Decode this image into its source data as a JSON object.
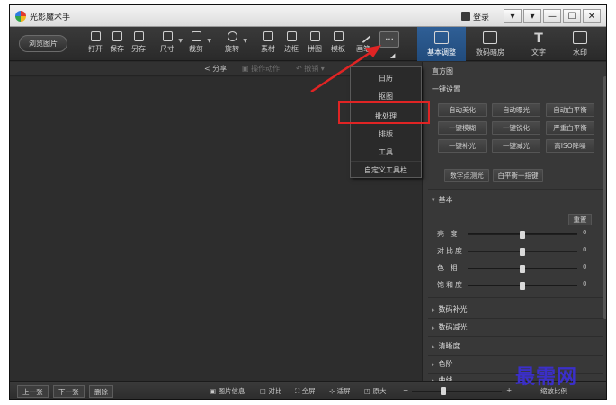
{
  "app": {
    "title": "光影魔术手",
    "login": "登录",
    "window_buttons": [
      "▾",
      "▾",
      "—",
      "☐",
      "✕"
    ]
  },
  "toolbar": {
    "browse": "浏览图片",
    "tools": [
      "打开",
      "保存",
      "另存",
      "尺寸",
      "裁剪",
      "旋转",
      "素材",
      "边框",
      "拼图",
      "模板",
      "画笔"
    ],
    "more": "···",
    "right_tabs": [
      "基本调整",
      "数码暗房",
      "文字",
      "水印"
    ],
    "active_tab": "基本调整"
  },
  "canvas_bar": {
    "share": "分享",
    "ops": "操作动作",
    "undo": "撤销"
  },
  "menu": {
    "items": [
      "日历",
      "抠图",
      "批处理",
      "排版",
      "工具",
      "自定义工具栏"
    ],
    "highlighted": "批处理"
  },
  "panel": {
    "histogram": "直方图",
    "quick": "一键设置",
    "quick_buttons": [
      "自动美化",
      "自动曝光",
      "自动白平衡",
      "一键模糊",
      "一键锐化",
      "严重白平衡",
      "一键补光",
      "一键减光",
      "高ISO降噪"
    ],
    "extra_buttons": [
      "数字点测光",
      "白平衡一指键"
    ],
    "basic": "基本",
    "reset": "重置",
    "sliders": [
      {
        "label": "亮 度",
        "value": "0",
        "level": 0.5
      },
      {
        "label": "对比度",
        "value": "0",
        "level": 0.5
      },
      {
        "label": "色 相",
        "value": "0",
        "level": 0.5
      },
      {
        "label": "饱和度",
        "value": "0",
        "level": 0.5
      }
    ],
    "sections": [
      "数码补光",
      "数码减光",
      "清晰度",
      "色阶",
      "曲线"
    ]
  },
  "bottombar": {
    "prev": "上一张",
    "next": "下一张",
    "delete": "删除",
    "info": "图片信息",
    "compare": "对比",
    "fullscreen": "全屏",
    "fit": "适屏",
    "original": "原大",
    "zoom_level": 0.35,
    "zoom_text": "缩放比例"
  },
  "watermark": "最需网",
  "colors": {
    "accent": "#2a5a92",
    "highlight": "#e02424",
    "watermark": "#3b2fc9"
  }
}
